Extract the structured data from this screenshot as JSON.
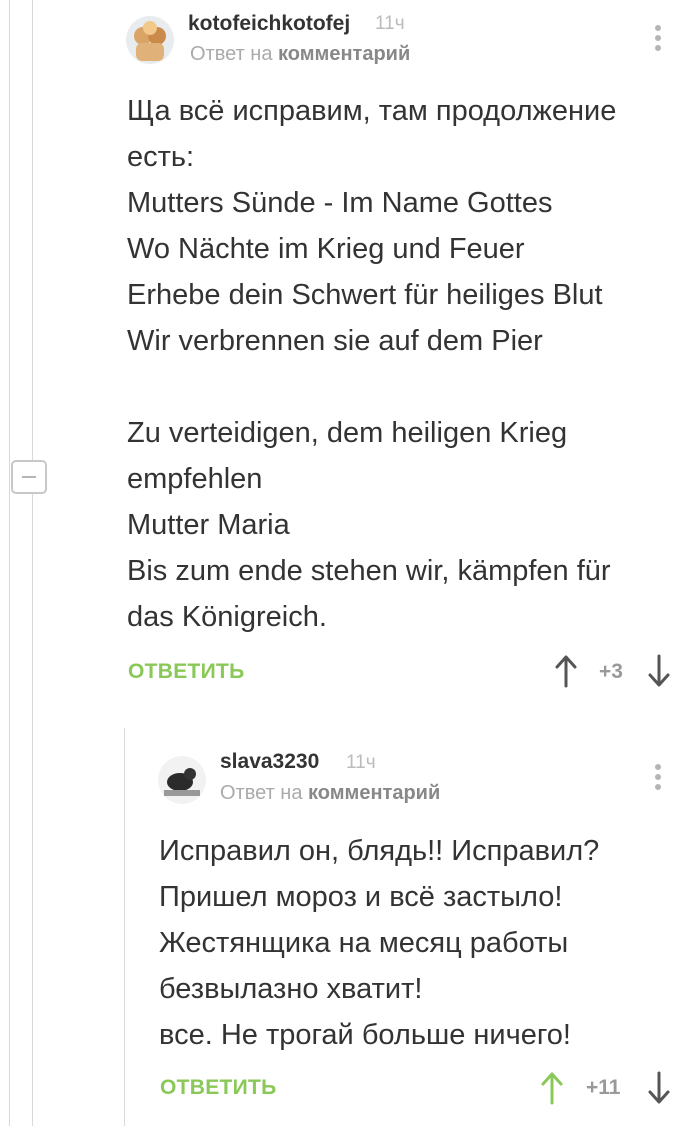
{
  "comments": [
    {
      "username": "kotofeichkotofej",
      "time": "11ч",
      "reply_prefix": "Ответ на",
      "reply_target": "комментарий",
      "body_lines": [
        "Ща всё исправим, там продолжение",
        "есть:",
        "Mutters Sünde - Im Name Gottes",
        "Wo Nächte im Krieg und Feuer",
        "Erhebe dein Schwert für heiliges Blut",
        "Wir verbrennen sie auf dem Pier",
        "",
        "Zu verteidigen, dem heiligen Krieg",
        "empfehlen",
        "Mutter Maria",
        "Bis zum ende stehen wir, kämpfen für",
        "das Königreich."
      ],
      "reply_label": "ОТВЕТИТЬ",
      "rating": "+3",
      "upvoted": false
    },
    {
      "username": "slava3230",
      "time": "11ч",
      "reply_prefix": "Ответ на",
      "reply_target": "комментарий",
      "body_lines": [
        "Исправил он, блядь!! Исправил?",
        "Пришел мороз и всё застыло!",
        "Жестянщика на месяц работы",
        "безвылазно хватит!",
        "все. Не трогай больше ничего!"
      ],
      "reply_label": "ОТВЕТИТЬ",
      "rating": "+11",
      "upvoted": true
    }
  ],
  "colors": {
    "accent_green": "#8ac858",
    "upvote_active": "#8ac858",
    "vote_inactive": "#555555"
  },
  "icons": [
    "collapse-minus-icon",
    "more-dots-icon",
    "arrow-up-icon",
    "arrow-down-icon"
  ]
}
